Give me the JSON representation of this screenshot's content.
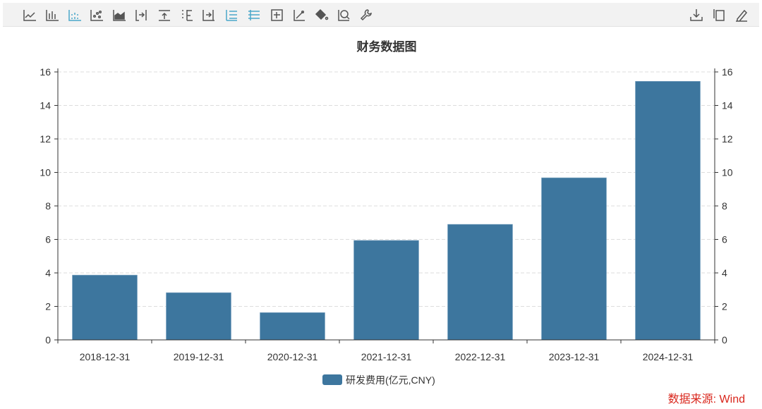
{
  "toolbar": {
    "left_icons": [
      "line-chart-icon",
      "bar-chart-icon",
      "stacked-bar-icon",
      "scatter-icon",
      "area-chart-icon",
      "align-right-icon",
      "align-top-icon",
      "split-axis-icon",
      "align-bottom-icon",
      "list-icon",
      "tiled-list-icon",
      "add-box-icon",
      "trend-line-icon",
      "fill-color-icon",
      "zoom-icon",
      "settings-wrench-icon"
    ],
    "active_icons": [
      2,
      9,
      10
    ],
    "right_icons": [
      "download-icon",
      "copy-icon",
      "edit-icon"
    ],
    "active_color": "#4aa7c9",
    "icon_color": "#555555"
  },
  "source": "数据来源: Wind",
  "chart_data": {
    "type": "bar",
    "title": "财务数据图",
    "categories": [
      "2018-12-31",
      "2019-12-31",
      "2020-12-31",
      "2021-12-31",
      "2022-12-31",
      "2023-12-31",
      "2024-12-31"
    ],
    "series": [
      {
        "name": "研发费用(亿元,CNY)",
        "values": [
          3.87,
          2.82,
          1.63,
          5.94,
          6.9,
          9.68,
          15.44
        ],
        "color": "#3d769e"
      }
    ],
    "yticks": [
      "0",
      "2",
      "4",
      "6",
      "8",
      "10",
      "12",
      "14",
      "16"
    ],
    "ylim": [
      0,
      16
    ],
    "y2ticks": [
      "0",
      "2",
      "4",
      "6",
      "8",
      "10",
      "12",
      "14",
      "16"
    ],
    "grid": true,
    "legend": "bottom-center",
    "xlabel": "",
    "ylabel": ""
  }
}
